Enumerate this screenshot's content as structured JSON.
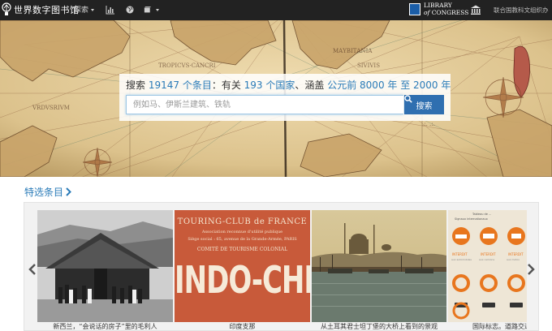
{
  "topnav": {
    "site_title": "世界数字图书馆",
    "explore_label": "探索",
    "logo_icon": "lightbulb-icon",
    "chart_icon": "bar-chart-icon",
    "globe_icon": "globe-icon",
    "books_icon": "books-icon",
    "partner_logo_text_line1": "LIBRARY",
    "partner_logo_text_line2": "of",
    "partner_logo_text_line3": "CONGRESS",
    "unesco_icon": "temple-icon",
    "unesco_label": "联合国教科文组织办"
  },
  "search": {
    "prefix": "搜索 ",
    "item_count": "19147 个条目",
    "mid1": "：有关 ",
    "country_count": "193 个国家",
    "mid2": "、涵盖 ",
    "time_range": "公元前 8000 年 至 2000 年",
    "placeholder": "例如马、伊斯兰建筑、铁轨",
    "button_label": "搜索",
    "button_icon": "search-icon"
  },
  "featured": {
    "title": "特选条目",
    "items": [
      {
        "caption": "新西兰，“会说话的房子”里的毛利人"
      },
      {
        "caption": "印度支那",
        "poster_head": "TOURING-CLUB de FRANCE",
        "poster_line1": "Association reconnue d'utilité publique",
        "poster_line2": "Siège social : 65, avenue de la Grande-Armée, PARIS",
        "poster_line3": "COMITÉ DE TOURISME COLONIAL",
        "poster_big": "INDO-CHINE"
      },
      {
        "caption": "从土耳其君士坦丁堡的大桥上看到的景观"
      },
      {
        "caption": "国际标志。道路交通"
      }
    ]
  },
  "colors": {
    "nav_bg": "#222222",
    "link_blue": "#2a7bb8",
    "button_blue": "#2f6fb0",
    "poster_red": "#c85a3a"
  }
}
